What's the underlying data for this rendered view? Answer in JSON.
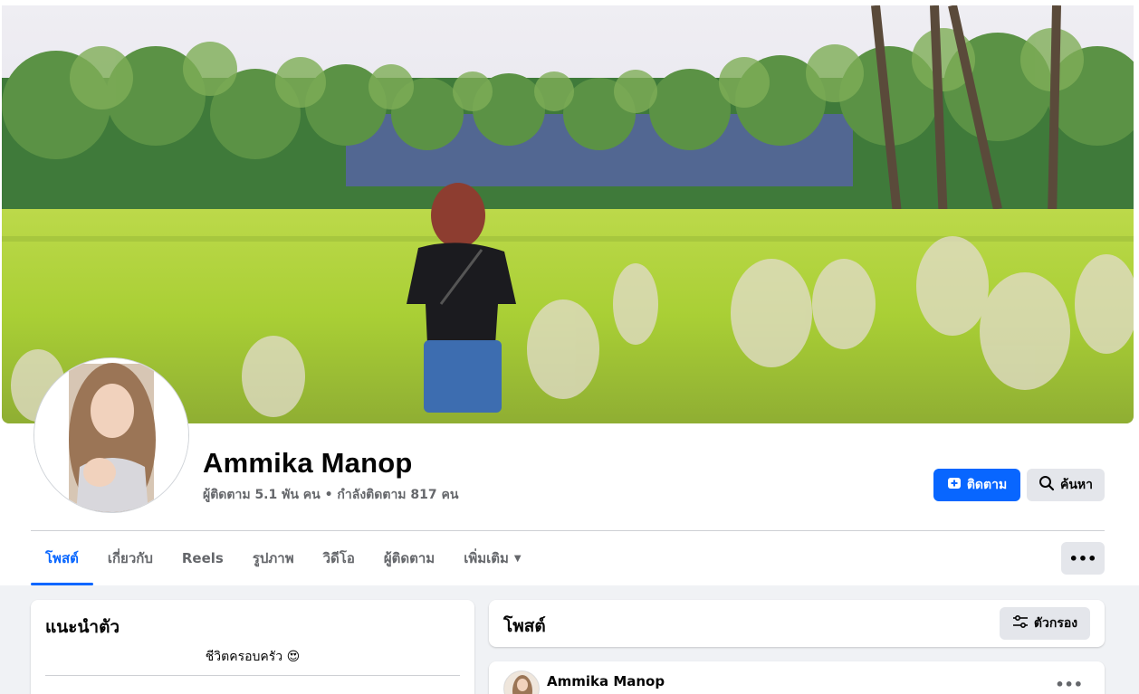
{
  "profile": {
    "name": "Ammika Manop",
    "stats": "ผู้ติดตาม 5.1 พัน คน • กำลังติดตาม 817 คน"
  },
  "actions": {
    "follow_label": "ติดตาม",
    "search_label": "ค้นหา",
    "more_label": "•••"
  },
  "tabs": [
    {
      "label": "โพสต์",
      "active": true
    },
    {
      "label": "เกี่ยวกับ"
    },
    {
      "label": "Reels"
    },
    {
      "label": "รูปภาพ"
    },
    {
      "label": "วิดีโอ"
    },
    {
      "label": "ผู้ติดตาม"
    },
    {
      "label": "เพิ่มเติม",
      "caret": "▼"
    }
  ],
  "intro": {
    "title": "แนะนำตัว",
    "bio": "ชีวิตครอบครัว 😍"
  },
  "posts": {
    "title": "โพสต์",
    "filter_label": "ตัวกรอง"
  },
  "post": {
    "author": "Ammika Manop",
    "more_label": "•••"
  },
  "colors": {
    "accent": "#0866ff",
    "secondary_button": "#e4e6eb",
    "page_bg": "#f0f2f5"
  },
  "icons": {
    "follow": "follow-plus-icon",
    "search": "search-icon",
    "filter": "filter-sliders-icon",
    "caret": "caret-down-icon"
  }
}
